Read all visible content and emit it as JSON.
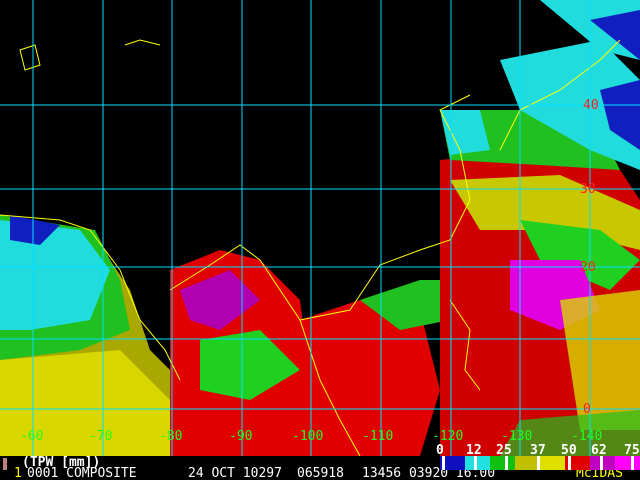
{
  "product_label": "(TPW [mm])",
  "info_line": {
    "frame": "1",
    "header": "0001 COMPOSITE",
    "date": "24 OCT 10297",
    "time": "065918",
    "values": "13456 03920 16.00",
    "brand": "McIDAS"
  },
  "lat_labels": [
    "40",
    "30",
    "20",
    "0"
  ],
  "lon_labels": [
    "-60",
    "-70",
    "-80",
    "-90",
    "-100",
    "-110",
    "-120",
    "-130",
    "-140"
  ],
  "legend": {
    "values": [
      "0",
      "12",
      "25",
      "37",
      "50",
      "62",
      "75"
    ],
    "colors": [
      "#1010c0",
      "#20e0e0",
      "#10c010",
      "#c0c000",
      "#e0e000",
      "#e00000",
      "#c000c0",
      "#ff00ff"
    ]
  },
  "colors": {
    "grid": "#00e0ff",
    "coast": "#ffff00",
    "lat_label": "#ff2020",
    "lon_label": "#20ff20"
  }
}
